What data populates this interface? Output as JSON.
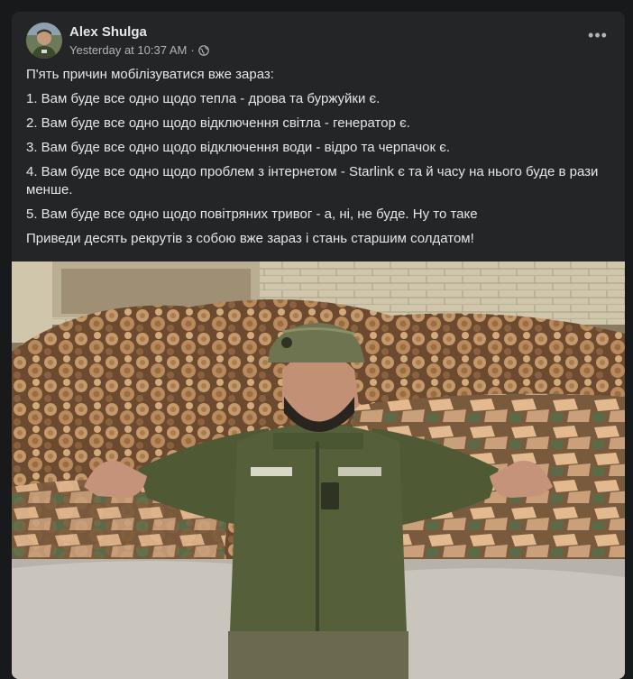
{
  "post": {
    "author": "Alex Shulga",
    "timestamp": "Yesterday at 10:37 AM",
    "separator": "·",
    "privacy_icon": "globe-icon",
    "more_icon": "more-options-icon",
    "more_label": "•••",
    "lines": [
      "П'ять причин мобілізуватися вже зараз:",
      "1. Вам буде все одно щодо тепла - дрова та буржуйки є.",
      "2. Вам буде все одно щодо відключення світла - генератор є.",
      "3. Вам буде все одно щодо відключення води - відро та черпачок є.",
      "4. Вам буде все одно щодо проблем з інтернетом - Starlink є та й часу на нього буде в рази менше.",
      "5. Вам буде все одно щодо повітряних тривог - а, ні, не буде. Ну то таке",
      "Приведи десять рекрутів з собою вже зараз і стань старшим солдатом!"
    ]
  },
  "colors": {
    "background": "#18191a",
    "card": "#242526",
    "primary_text": "#e4e6eb",
    "secondary_text": "#b0b3b8",
    "jacket": "#4f5a35"
  }
}
